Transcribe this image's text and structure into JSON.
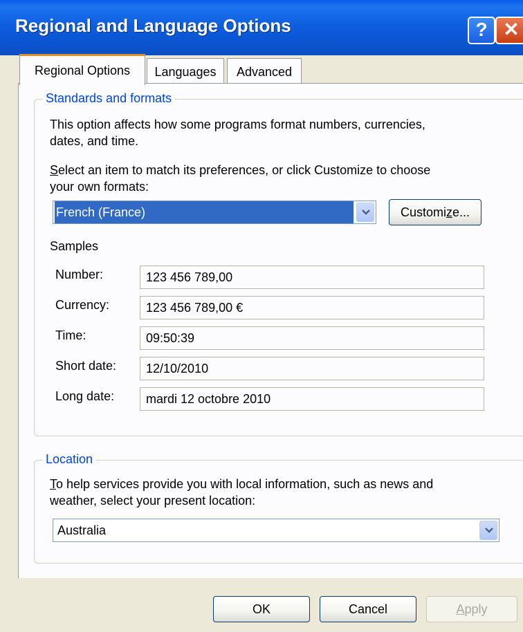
{
  "window": {
    "title": "Regional and Language Options"
  },
  "title_buttons": {
    "help": "?",
    "close": "✕"
  },
  "tabs": [
    {
      "label": "Regional Options",
      "active": true
    },
    {
      "label": "Languages",
      "active": false
    },
    {
      "label": "Advanced",
      "active": false
    }
  ],
  "standards": {
    "legend": "Standards and formats",
    "description_line1": "This option affects how some programs format numbers, currencies,",
    "description_line2": "dates, and time.",
    "select_prompt_line1_first": "S",
    "select_prompt_line1_rest": "elect an item to match its preferences, or click Customize to choose",
    "select_prompt_line2": "your own formats:",
    "format_value": "French (France)",
    "customize_label_pre": "Customi",
    "customize_label_key": "z",
    "customize_label_post": "e...",
    "samples_heading": "Samples",
    "samples": [
      {
        "label": "Number:",
        "value": "123 456 789,00"
      },
      {
        "label": "Currency:",
        "value": "123 456 789,00 €"
      },
      {
        "label": "Time:",
        "value": "09:50:39"
      },
      {
        "label": "Short date:",
        "value": "12/10/2010"
      },
      {
        "label": "Long date:",
        "value": "mardi 12 octobre 2010"
      }
    ]
  },
  "location": {
    "legend": "Location",
    "description_line1_first": "T",
    "description_line1_rest": "o help services provide you with local information, such as news and",
    "description_line2": "weather, select your present location:",
    "value": "Australia"
  },
  "buttons": {
    "ok": "OK",
    "cancel": "Cancel",
    "apply_key": "A",
    "apply_rest": "pply"
  },
  "icons": {
    "combo_arrow": "chevron-down-icon",
    "help": "help-icon",
    "close": "close-icon"
  }
}
